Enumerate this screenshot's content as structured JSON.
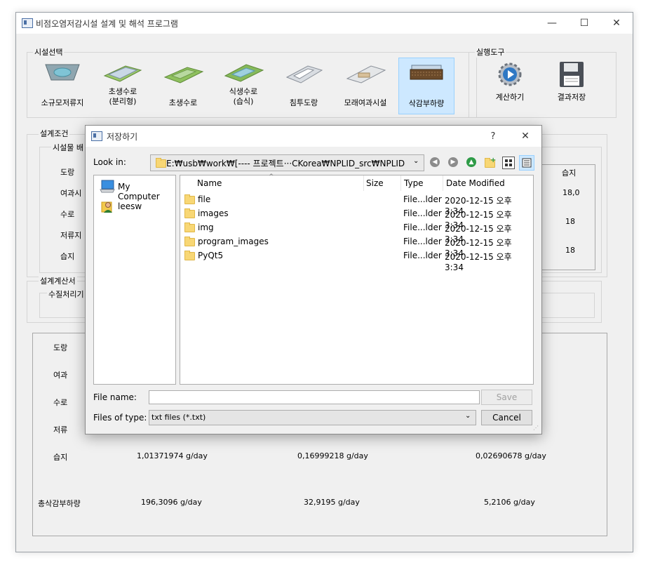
{
  "window": {
    "title": "비점오염저감시설 설계 및 해석 프로그램",
    "controls": [
      "—",
      "☐",
      "✕"
    ]
  },
  "facility_select": {
    "title": "시설선택",
    "tools": [
      {
        "label": "소규모저류지",
        "icon": "small-reservoir-icon"
      },
      {
        "label": "초생수로\n(분리형)",
        "icon": "grass-channel-separated-icon"
      },
      {
        "label": "초생수로",
        "icon": "grass-channel-icon"
      },
      {
        "label": "식생수로\n(습식)",
        "icon": "vegetated-channel-wet-icon"
      },
      {
        "label": "침투도랑",
        "icon": "infiltration-trench-icon"
      },
      {
        "label": "모래여과시설",
        "icon": "sand-filter-icon"
      },
      {
        "label": "삭감부하량",
        "icon": "load-reduction-icon",
        "selected": true
      }
    ]
  },
  "exec_tools": {
    "title": "실행도구",
    "tools": [
      {
        "label": "계산하기",
        "icon": "gear-play-icon"
      },
      {
        "label": "결과저장",
        "icon": "save-disk-icon"
      }
    ]
  },
  "design_conditions": {
    "title": "설계조건",
    "subtitle": "시설물 배",
    "rows": [
      "도랑",
      "여과시",
      "수로",
      "저류지",
      "습지"
    ],
    "right_header": "습지",
    "right_values": [
      "18,0",
      "18",
      "18"
    ]
  },
  "calc_report": {
    "title": "설계계산서",
    "subtitle": "수질처리기"
  },
  "results": {
    "row_labels": [
      "도랑",
      "여과",
      "수로",
      "저류",
      "습지",
      "총삭감부하량"
    ],
    "wetland_row": [
      "1,01371974 g/day",
      "0,16999218 g/day",
      "0,02690678 g/day"
    ],
    "total_row": [
      "196,3096 g/day",
      "32,9195 g/day",
      "5,2106 g/day"
    ]
  },
  "dialog": {
    "title": "저장하기",
    "help": "?",
    "close": "✕",
    "look_in_label": "Look in:",
    "look_in_path": "E:₩usb₩work₩[---- 프로젝트···CKorea₩NPLID_src₩NPLID",
    "places": [
      {
        "label": "My Computer",
        "icon": "computer-icon"
      },
      {
        "label": "leesw",
        "icon": "user-icon"
      }
    ],
    "columns": [
      "Name",
      "Size",
      "Type",
      "Date Modified"
    ],
    "files": [
      {
        "name": "file",
        "size": "",
        "type": "File...lder",
        "date": "2020-12-15 오후 3:34"
      },
      {
        "name": "images",
        "size": "",
        "type": "File...lder",
        "date": "2020-12-15 오후 3:34"
      },
      {
        "name": "img",
        "size": "",
        "type": "File...lder",
        "date": "2020-12-15 오후 3:34"
      },
      {
        "name": "program_images",
        "size": "",
        "type": "File...lder",
        "date": "2020-12-15 오후 3:34"
      },
      {
        "name": "PyQt5",
        "size": "",
        "type": "File...lder",
        "date": "2020-12-15 오후 3:34"
      }
    ],
    "file_name_label": "File name:",
    "file_name_value": "",
    "file_type_label": "Files of type:",
    "file_type_value": "txt files (*.txt)",
    "save_label": "Save",
    "cancel_label": "Cancel"
  }
}
